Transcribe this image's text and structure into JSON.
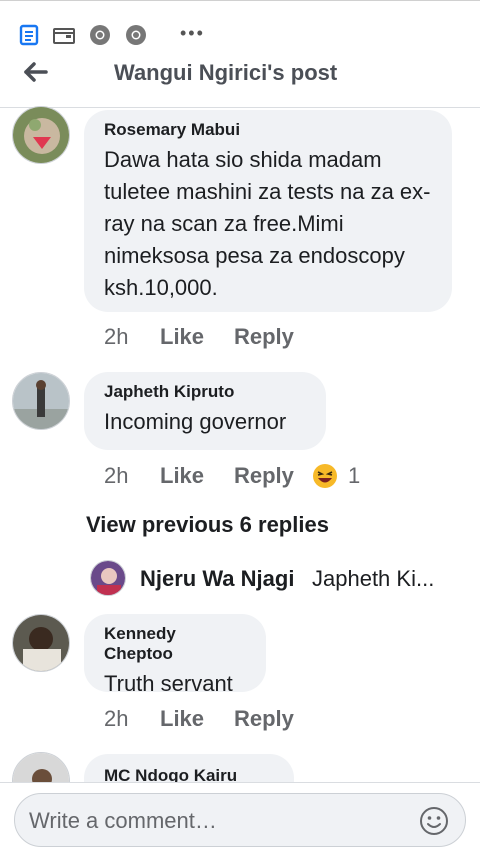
{
  "header": {
    "title": "Wangui Ngirici's post"
  },
  "comments": [
    {
      "author": "Rosemary Mabui",
      "text": "Dawa hata sio shida madam tuletee mashini za tests na za ex-ray na scan za free.Mimi nimeksosa pesa za endoscopy ksh.10,000.",
      "time": "2h",
      "like": "Like",
      "reply": "Reply"
    },
    {
      "author": "Japheth Kipruto",
      "text": "Incoming governor",
      "time": "2h",
      "like": "Like",
      "reply": "Reply",
      "reaction_count": "1"
    },
    {
      "author": "Kennedy Cheptoo",
      "text": "Truth servant",
      "time": "2h",
      "like": "Like",
      "reply": "Reply"
    },
    {
      "author": "MC Ndogo Kairu"
    }
  ],
  "view_previous": "View previous 6 replies",
  "reply_preview": {
    "author": "Njeru Wa Njagi",
    "text": "Japheth Ki..."
  },
  "composer": {
    "placeholder": "Write a comment…"
  },
  "icons": [
    "news-feed-icon",
    "wallet-icon",
    "chrome-icon",
    "chrome-icon",
    "more-dots-icon",
    "back-arrow-icon",
    "laughing-emoji-icon",
    "smiley-icon"
  ],
  "colors": {
    "accent": "#1877f2",
    "bubble": "#f0f2f5",
    "secondary_text": "#65676b"
  }
}
